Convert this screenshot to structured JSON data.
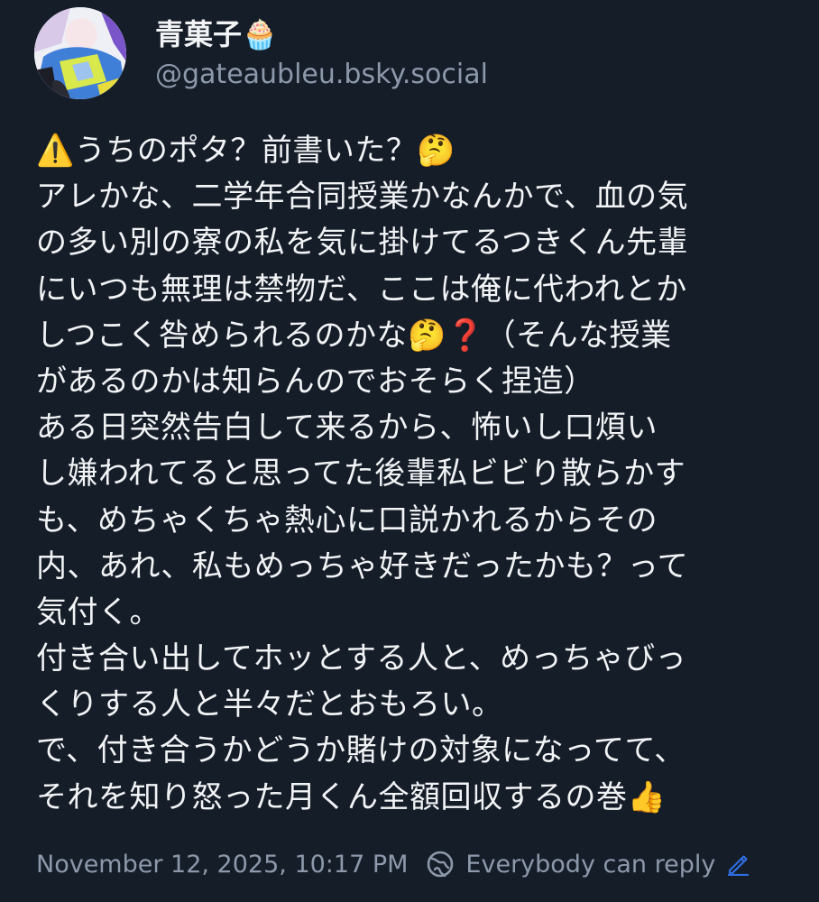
{
  "author": {
    "display_name": "青菓子🧁",
    "handle": "@gateaubleu.bsky.social",
    "avatar_icon": "avatar-image"
  },
  "post": {
    "lines": [
      "⚠️うちのポタ？前書いた？🤔",
      "アレかな、二学年合同授業かなんかで、血の気",
      "の多い別の寮の私を気に掛けてるつきくん先輩",
      "にいつも無理は禁物だ、ここは俺に代われとか",
      "しつこく咎められるのかな🤔❓（そんな授業",
      "があるのかは知らんのでおそらく捏造）",
      "ある日突然告白して来るから、怖いし口煩い",
      "し嫌われてると思ってた後輩私ビビり散らかす",
      "も、めちゃくちゃ熱心に口説かれるからその",
      "内、あれ、私もめっちゃ好きだったかも？って",
      "気付く。",
      "付き合い出してホッとする人と、めっちゃびっ",
      "くりする人と半々だとおもろい。",
      "で、付き合うかどうか賭けの対象になってて、",
      "それを知り怒った月くん全額回収するの巻👍"
    ]
  },
  "footer": {
    "timestamp": "November 12, 2025, 10:17 PM",
    "reply_setting": "Everybody can reply",
    "reply_icon": "globe-icon",
    "edit_icon": "pencil-icon"
  },
  "colors": {
    "background": "#151d28",
    "text": "#f1f3f5",
    "muted": "#8d99ab",
    "accent": "#2f6de0"
  }
}
